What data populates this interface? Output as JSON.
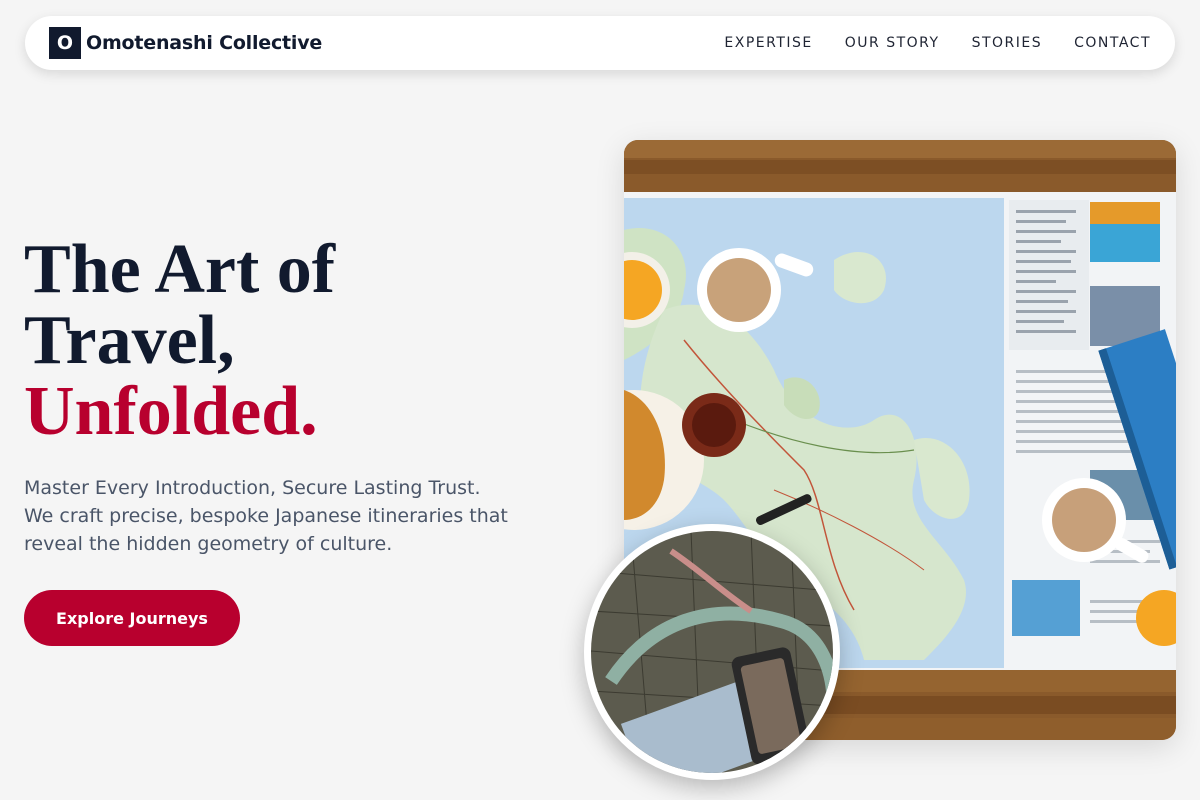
{
  "brand": {
    "logo_letter": "O",
    "name": "Omotenashi Collective"
  },
  "nav": {
    "links": [
      "EXPERTISE",
      "OUR STORY",
      "STORIES",
      "CONTACT"
    ]
  },
  "hero": {
    "headline_line1": "The Art of",
    "headline_line2": "Travel,",
    "headline_accent": "Unfolded.",
    "subtext_line1": "Master Every Introduction, Secure Lasting Trust.",
    "subtext_line2": "We craft precise, bespoke Japanese itineraries that",
    "subtext_line3": "reveal the hidden geometry of culture.",
    "cta_label": "Explore Journeys"
  },
  "colors": {
    "primary": "#111a2e",
    "accent": "#b8002e",
    "background": "#f5f5f5"
  }
}
